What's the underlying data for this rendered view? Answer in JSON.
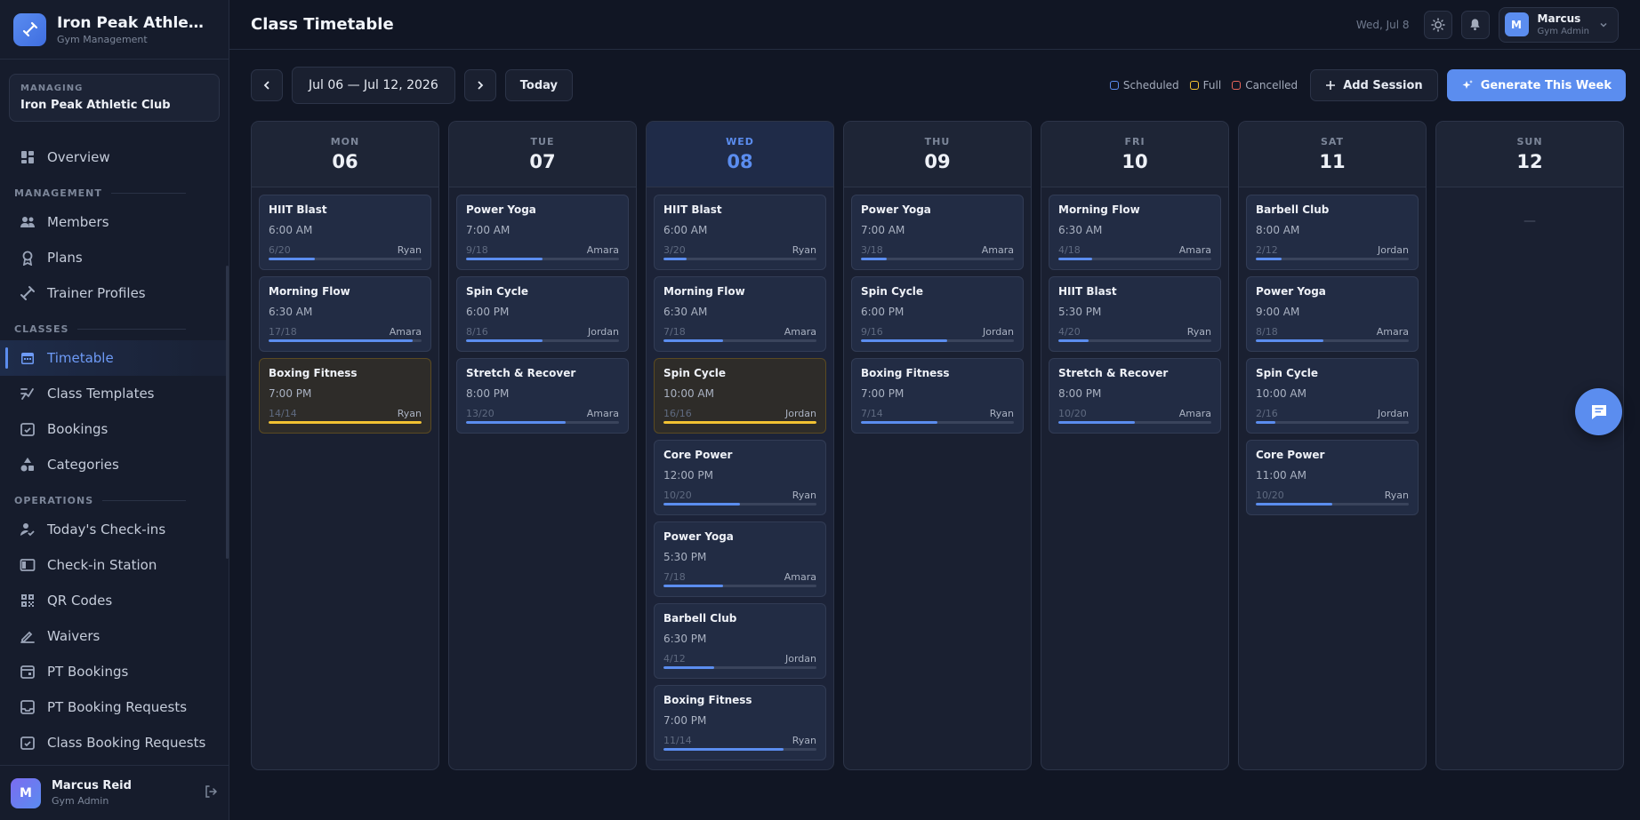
{
  "brand": {
    "name": "Iron Peak Athle…",
    "sub": "Gym Management"
  },
  "managing": {
    "label": "MANAGING",
    "club": "Iron Peak Athletic Club"
  },
  "nav": {
    "overview": "Overview",
    "section_management": "MANAGEMENT",
    "members": "Members",
    "plans": "Plans",
    "trainers": "Trainer Profiles",
    "section_classes": "CLASSES",
    "timetable": "Timetable",
    "templates": "Class Templates",
    "bookings": "Bookings",
    "categories": "Categories",
    "section_operations": "OPERATIONS",
    "checkins": "Today's Check-ins",
    "station": "Check-in Station",
    "qr": "QR Codes",
    "waivers": "Waivers",
    "pt_bookings": "PT Bookings",
    "pt_requests": "PT Booking Requests",
    "class_requests": "Class Booking Requests"
  },
  "footer_user": {
    "initial": "M",
    "name": "Marcus Reid",
    "role": "Gym Admin"
  },
  "topbar": {
    "title": "Class Timetable",
    "date": "Wed, Jul 8",
    "user_initial": "M",
    "user_name": "Marcus",
    "user_role": "Gym Admin"
  },
  "toolbar": {
    "range": "Jul 06 — Jul 12, 2026",
    "today": "Today",
    "add": "Add Session",
    "generate": "Generate This Week"
  },
  "legend": {
    "scheduled": "Scheduled",
    "full": "Full",
    "cancelled": "Cancelled"
  },
  "colors": {
    "scheduled": "#5b8def",
    "full": "#f2c232",
    "cancelled": "#e8655a"
  },
  "empty_marker": "—",
  "days": [
    {
      "name": "MON",
      "num": "06",
      "today": false,
      "sessions": [
        {
          "title": "HIIT Blast",
          "time": "6:00 AM",
          "cap": "6/20",
          "trainer": "Ryan",
          "fill": 0.3,
          "status": "scheduled"
        },
        {
          "title": "Morning Flow",
          "time": "6:30 AM",
          "cap": "17/18",
          "trainer": "Amara",
          "fill": 0.944,
          "status": "scheduled"
        },
        {
          "title": "Boxing Fitness",
          "time": "7:00 PM",
          "cap": "14/14",
          "trainer": "Ryan",
          "fill": 1.0,
          "status": "full"
        }
      ]
    },
    {
      "name": "TUE",
      "num": "07",
      "today": false,
      "sessions": [
        {
          "title": "Power Yoga",
          "time": "7:00 AM",
          "cap": "9/18",
          "trainer": "Amara",
          "fill": 0.5,
          "status": "scheduled"
        },
        {
          "title": "Spin Cycle",
          "time": "6:00 PM",
          "cap": "8/16",
          "trainer": "Jordan",
          "fill": 0.5,
          "status": "scheduled"
        },
        {
          "title": "Stretch & Recover",
          "time": "8:00 PM",
          "cap": "13/20",
          "trainer": "Amara",
          "fill": 0.65,
          "status": "scheduled"
        }
      ]
    },
    {
      "name": "WED",
      "num": "08",
      "today": true,
      "sessions": [
        {
          "title": "HIIT Blast",
          "time": "6:00 AM",
          "cap": "3/20",
          "trainer": "Ryan",
          "fill": 0.15,
          "status": "scheduled"
        },
        {
          "title": "Morning Flow",
          "time": "6:30 AM",
          "cap": "7/18",
          "trainer": "Amara",
          "fill": 0.389,
          "status": "scheduled"
        },
        {
          "title": "Spin Cycle",
          "time": "10:00 AM",
          "cap": "16/16",
          "trainer": "Jordan",
          "fill": 1.0,
          "status": "full"
        },
        {
          "title": "Core Power",
          "time": "12:00 PM",
          "cap": "10/20",
          "trainer": "Ryan",
          "fill": 0.5,
          "status": "scheduled"
        },
        {
          "title": "Power Yoga",
          "time": "5:30 PM",
          "cap": "7/18",
          "trainer": "Amara",
          "fill": 0.389,
          "status": "scheduled"
        },
        {
          "title": "Barbell Club",
          "time": "6:30 PM",
          "cap": "4/12",
          "trainer": "Jordan",
          "fill": 0.333,
          "status": "scheduled"
        },
        {
          "title": "Boxing Fitness",
          "time": "7:00 PM",
          "cap": "11/14",
          "trainer": "Ryan",
          "fill": 0.786,
          "status": "scheduled"
        }
      ]
    },
    {
      "name": "THU",
      "num": "09",
      "today": false,
      "sessions": [
        {
          "title": "Power Yoga",
          "time": "7:00 AM",
          "cap": "3/18",
          "trainer": "Amara",
          "fill": 0.167,
          "status": "scheduled"
        },
        {
          "title": "Spin Cycle",
          "time": "6:00 PM",
          "cap": "9/16",
          "trainer": "Jordan",
          "fill": 0.5625,
          "status": "scheduled"
        },
        {
          "title": "Boxing Fitness",
          "time": "7:00 PM",
          "cap": "7/14",
          "trainer": "Ryan",
          "fill": 0.5,
          "status": "scheduled"
        }
      ]
    },
    {
      "name": "FRI",
      "num": "10",
      "today": false,
      "sessions": [
        {
          "title": "Morning Flow",
          "time": "6:30 AM",
          "cap": "4/18",
          "trainer": "Amara",
          "fill": 0.222,
          "status": "scheduled"
        },
        {
          "title": "HIIT Blast",
          "time": "5:30 PM",
          "cap": "4/20",
          "trainer": "Ryan",
          "fill": 0.2,
          "status": "scheduled"
        },
        {
          "title": "Stretch & Recover",
          "time": "8:00 PM",
          "cap": "10/20",
          "trainer": "Amara",
          "fill": 0.5,
          "status": "scheduled"
        }
      ]
    },
    {
      "name": "SAT",
      "num": "11",
      "today": false,
      "sessions": [
        {
          "title": "Barbell Club",
          "time": "8:00 AM",
          "cap": "2/12",
          "trainer": "Jordan",
          "fill": 0.167,
          "status": "scheduled"
        },
        {
          "title": "Power Yoga",
          "time": "9:00 AM",
          "cap": "8/18",
          "trainer": "Amara",
          "fill": 0.444,
          "status": "scheduled"
        },
        {
          "title": "Spin Cycle",
          "time": "10:00 AM",
          "cap": "2/16",
          "trainer": "Jordan",
          "fill": 0.125,
          "status": "scheduled"
        },
        {
          "title": "Core Power",
          "time": "11:00 AM",
          "cap": "10/20",
          "trainer": "Ryan",
          "fill": 0.5,
          "status": "scheduled"
        }
      ]
    },
    {
      "name": "SUN",
      "num": "12",
      "today": false,
      "sessions": []
    }
  ]
}
